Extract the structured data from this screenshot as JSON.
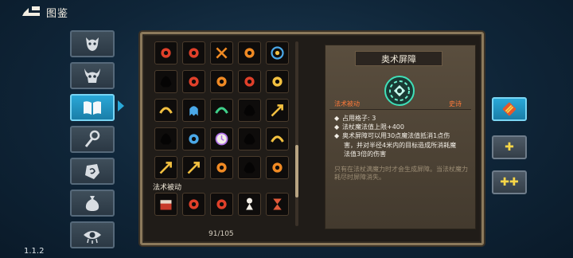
{
  "header": {
    "title": "图鉴",
    "back_icon": "back-arrow-icon"
  },
  "version": "1.1.2",
  "categories": [
    {
      "id": "monster",
      "icon": "demon-face-icon",
      "active": false
    },
    {
      "id": "boss",
      "icon": "horned-skull-icon",
      "active": false
    },
    {
      "id": "book",
      "icon": "open-book-icon",
      "active": true
    },
    {
      "id": "staff",
      "icon": "staff-icon",
      "active": false
    },
    {
      "id": "rune",
      "icon": "rune-stone-icon",
      "active": false
    },
    {
      "id": "bag",
      "icon": "money-bag-icon",
      "active": false
    },
    {
      "id": "eye",
      "icon": "eye-icon",
      "active": false
    }
  ],
  "grid": {
    "section_label": "法术被动",
    "counter": "91/105",
    "rows_top": [
      [
        "red-flame-rune",
        "red-serpent-rune",
        "orange-cross-rune",
        "orange-swirl-rune",
        "blue-vortex-rune"
      ],
      [
        "locked-shadow",
        "red-flower-rune",
        "fire-burst-rune",
        "red-crown-rune",
        "gold-mask-rune"
      ],
      [
        "gold-arc-rune",
        "blue-ghost-rune",
        "rainbow-arc-rune",
        "locked-shadow",
        "double-arrow-rune"
      ],
      [
        "locked-shadow",
        "lightning-rune",
        "purple-clock-rune",
        "locked-shadow",
        "gold-bow-rune"
      ],
      [
        "gold-arrow-rune",
        "red-cross-arrows-rune",
        "flaming-sword-rune",
        "locked-shadow",
        "fire-wave-rune"
      ]
    ],
    "rows_bottom": [
      [
        "treasure-chest-passive",
        "spiked-creature-passive",
        "red-spiky-passive",
        "white-figure-passive",
        "hourglass-passive"
      ]
    ]
  },
  "detail": {
    "title": "奥术屏障",
    "icon": "arcane-barrier-icon",
    "type_label": "法术被动",
    "rarity_label": "史诗",
    "stats": [
      "占用格子: 3",
      "法杖魔法值上限+400",
      "奥术屏障可以用30点魔法值抵消1点伤"
    ],
    "desc_continuation": [
      "害，并对半径4米内的目标造成所消耗魔",
      "法值3倍的伤害"
    ],
    "flavor": "只有在法杖满魔力时才会生成屏障。当法杖魔力耗尽时屏障消失。"
  },
  "actions": [
    {
      "id": "filter",
      "icon": "striped-gem-icon",
      "active": true
    },
    {
      "id": "plus1",
      "label": "✚",
      "active": false
    },
    {
      "id": "plus2",
      "label": "✚✚",
      "active": false
    }
  ],
  "colors": {
    "accent": "#2aa8d8",
    "frame": "#8c7a5c",
    "type_tag": "#ff7a3a",
    "plus": "#f7d648"
  }
}
